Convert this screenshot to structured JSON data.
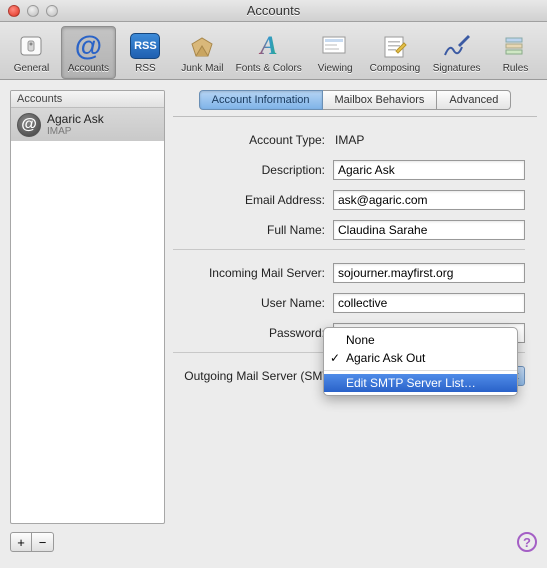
{
  "window": {
    "title": "Accounts"
  },
  "toolbar": {
    "general": "General",
    "accounts": "Accounts",
    "rss": "RSS",
    "junk": "Junk Mail",
    "fonts": "Fonts & Colors",
    "viewing": "Viewing",
    "composing": "Composing",
    "signatures": "Signatures",
    "rules": "Rules"
  },
  "sidebar": {
    "header": "Accounts",
    "account": {
      "name": "Agaric Ask",
      "proto": "IMAP"
    }
  },
  "tabs": {
    "info": "Account Information",
    "mailbox": "Mailbox Behaviors",
    "advanced": "Advanced"
  },
  "form": {
    "account_type_label": "Account Type:",
    "account_type": "IMAP",
    "description_label": "Description:",
    "description": "Agaric Ask",
    "email_label": "Email Address:",
    "email": "ask@agaric.com",
    "fullname_label": "Full Name:",
    "fullname": "Claudina Sarahe",
    "incoming_label": "Incoming Mail Server:",
    "incoming": "sojourner.mayfirst.org",
    "user_label": "User Name:",
    "user": "collective",
    "password_label": "Password:",
    "password": "•••••••••",
    "smtp_label": "Outgoing Mail Server (SMTP):"
  },
  "menu": {
    "none": "None",
    "selected": "Agaric Ask Out",
    "edit": "Edit SMTP Server List…"
  },
  "buttons": {
    "add": "+",
    "remove": "−",
    "help": "?"
  }
}
